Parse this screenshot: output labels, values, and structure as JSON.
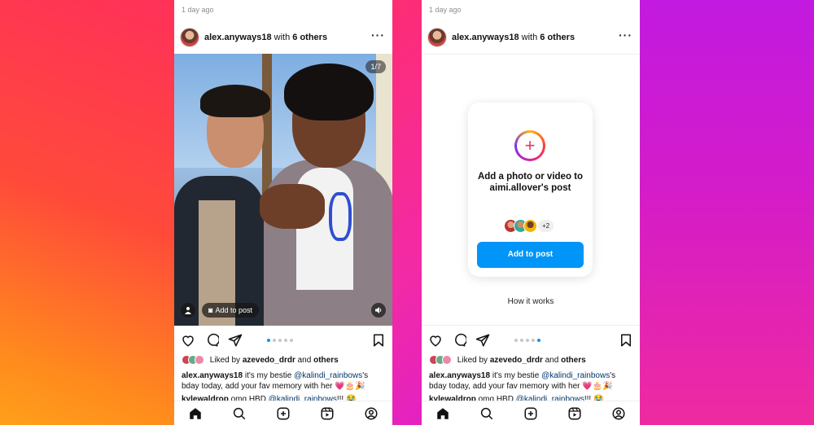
{
  "phones": [
    {
      "time": "1 day ago",
      "author": "alex.anyways18",
      "with_text": "with",
      "others": "6 others",
      "counter": "1/7",
      "add_to_post_chip": "Add to post",
      "liked_by_prefix": "Liked by",
      "liked_by_user": "azevedo_drdr",
      "liked_by_suffix": "and",
      "liked_by_others": "others",
      "caption_user": "alex.anyways18",
      "caption_text_1": "it's my bestie",
      "caption_mention": "@kalindi_rainbows",
      "caption_text_2": "'s bday today, add your fav memory with her 💗🎂🎉",
      "comment_user": "kylewaldrop",
      "comment_text": "omg HBD",
      "comment_mention": "@kalindi_rainbows",
      "comment_tail": "!!! 😭",
      "active_dot": 0
    },
    {
      "time": "1 day ago",
      "author": "alex.anyways18",
      "with_text": "with",
      "others": "6 others",
      "card_title": "Add a photo or video to aimi.allover's post",
      "more_count": "+2",
      "add_button": "Add to post",
      "how_it_works": "How it works",
      "liked_by_prefix": "Liked by",
      "liked_by_user": "azevedo_drdr",
      "liked_by_suffix": "and",
      "liked_by_others": "others",
      "caption_user": "alex.anyways18",
      "caption_text_1": "it's my bestie",
      "caption_mention": "@kalindi_rainbows",
      "caption_text_2": "'s bday today, add your fav memory with her 💗🎂🎉",
      "comment_user": "kylewaldrop",
      "comment_text": "omg HBD",
      "comment_mention": "@kalindi_rainbows",
      "comment_tail": "!!! 😭",
      "active_dot": 4
    }
  ],
  "icons": {
    "more": "more-icon",
    "like": "heart-icon",
    "comment": "comment-icon",
    "share": "share-icon",
    "save": "bookmark-icon",
    "home": "home-icon",
    "search": "search-icon",
    "create": "create-icon",
    "reels": "reels-icon",
    "profile": "profile-icon"
  },
  "colors": {
    "accent": "#0095f6",
    "mention": "#00376b"
  }
}
